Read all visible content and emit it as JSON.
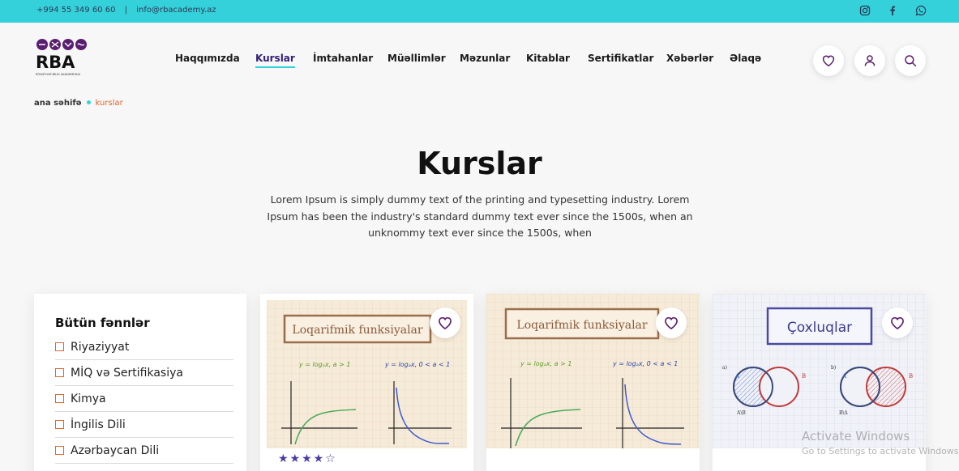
{
  "topbar": {
    "phone": "+994 55 349 60 60",
    "separator": "|",
    "email": "info@rbacademy.az",
    "social_icons": [
      "instagram-icon",
      "facebook-icon",
      "whatsapp-icon"
    ]
  },
  "brand": {
    "logo_text": "RBA",
    "logo_subtitle": "RİYAZİYYAT-BİLİK AKADEMİYASI"
  },
  "nav": {
    "items": [
      "Haqqımızda",
      "Kurslar",
      "İmtahanlar",
      "Müəllimlər",
      "Məzunlar",
      "Kitablar",
      "Sertifikatlar",
      "Xəbərlər",
      "Əlaqə"
    ],
    "active": "Kurslar"
  },
  "header_icons": [
    "heart-icon",
    "user-icon",
    "search-icon"
  ],
  "breadcrumb": {
    "home": "ana səhifə",
    "current": "kurslar"
  },
  "hero": {
    "title": "Kurslar",
    "text": "Lorem Ipsum is simply dummy text of the printing and typesetting industry. Lorem Ipsum has been the industry's standard dummy text ever since the 1500s, when an unknommy text ever since the 1500s, when"
  },
  "filter": {
    "title": "Bütün fənnlər",
    "items": [
      "Riyaziyyat",
      "MİQ və Sertifikasiya",
      "Kimya",
      "İngilis Dili",
      "Azərbaycan Dili"
    ]
  },
  "cards": [
    {
      "image_title": "Loqarifmik funksiyalar",
      "formula_left": "y = logₐx, a > 1",
      "formula_right": "y = logₐx, 0 < a < 1",
      "rating": 4,
      "stars": "★★★★☆"
    },
    {
      "image_title": "Loqarifmik funksiyalar",
      "formula_left": "y = logₐx, a > 1",
      "formula_right": "y = logₐx, 0 < a < 1"
    },
    {
      "image_title": "Çoxluqlar"
    }
  ],
  "watermark": {
    "line1": "Activate Windows",
    "line2": "Go to Settings to activate Windows."
  },
  "colors": {
    "topbar": "#35d1da",
    "brand_purple": "#5a1e6e",
    "accent_orange": "#e0652c",
    "star": "#4a3aa8"
  }
}
